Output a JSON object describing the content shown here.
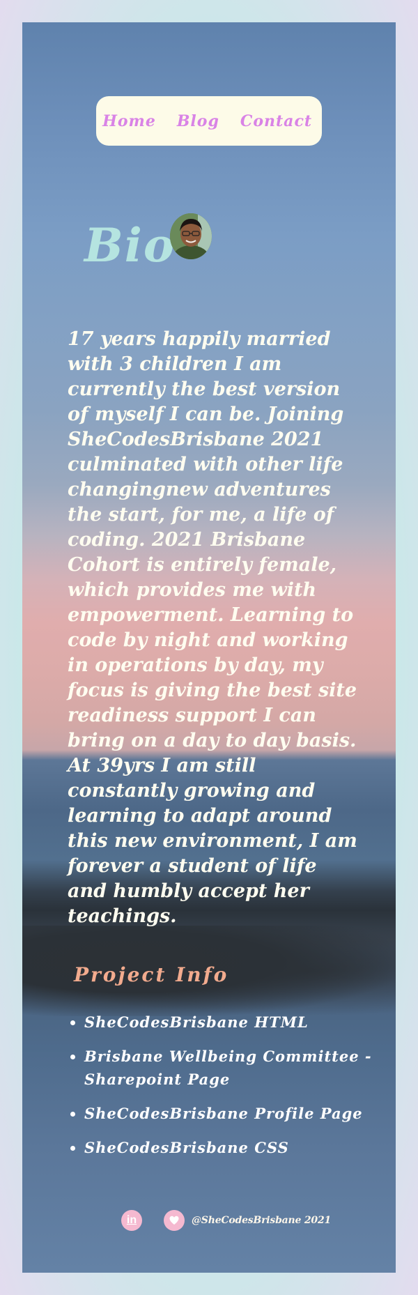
{
  "nav": {
    "items": [
      "Home",
      "Blog",
      "Contact"
    ]
  },
  "bio": {
    "title": "Bio",
    "avatar_icon": "profile-photo",
    "text": "17 years happily married with 3 children I am currently the best version of myself I can be. Joining SheCodesBrisbane 2021 culminated with other life changingnew adventures the start, for me, a life of coding. 2021 Brisbane Cohort is entirely female, which provides me with empowerment. Learning to code by night and working in operations by day, my focus is giving the best site readiness support I can bring on a day to day basis. At 39yrs I am still constantly growing and learning to adapt around this new environment, I am forever a student of life and humbly accept her teachings."
  },
  "projects": {
    "title": "Project Info",
    "items": [
      "SheCodesBrisbane HTML",
      "Brisbane Wellbeing Committee - Sharepoint Page",
      "SheCodesBrisbane Profile Page",
      "SheCodesBrisbane CSS"
    ]
  },
  "footer": {
    "linkedin_icon": "linkedin-icon",
    "heart_icon": "heart-icon",
    "linkedin_glyph": "in",
    "handle": "@SheCodesBrisbane 2021"
  },
  "colors": {
    "nav_bg": "#fdfbe8",
    "nav_link": "#d983e6",
    "bio_title": "#b5e4e0",
    "project_title": "#f2ab8e",
    "social_bg": "#f5b9d0"
  }
}
